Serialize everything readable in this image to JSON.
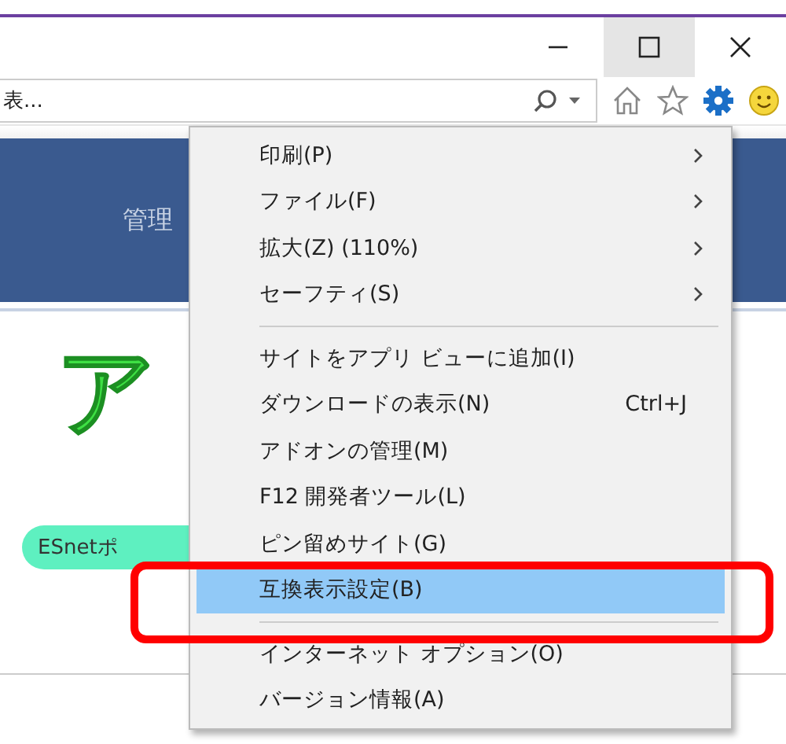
{
  "address_bar": {
    "value": "表..."
  },
  "page": {
    "nav_item": "管理",
    "logo_text": "ア",
    "portal_button": "ESnetポ"
  },
  "menu": {
    "items": [
      {
        "kind": "item",
        "label": "印刷(P)",
        "submenu": true,
        "selected": false
      },
      {
        "kind": "item",
        "label": "ファイル(F)",
        "submenu": true,
        "selected": false
      },
      {
        "kind": "item",
        "label": "拡大(Z) (110%)",
        "submenu": true,
        "selected": false
      },
      {
        "kind": "item",
        "label": "セーフティ(S)",
        "submenu": true,
        "selected": false
      },
      {
        "kind": "separator"
      },
      {
        "kind": "item",
        "label": "サイトをアプリ ビューに追加(I)",
        "submenu": false,
        "selected": false
      },
      {
        "kind": "item",
        "label": "ダウンロードの表示(N)",
        "shortcut": "Ctrl+J",
        "submenu": false,
        "selected": false
      },
      {
        "kind": "item",
        "label": "アドオンの管理(M)",
        "submenu": false,
        "selected": false
      },
      {
        "kind": "item",
        "label": "F12 開発者ツール(L)",
        "submenu": false,
        "selected": false
      },
      {
        "kind": "item",
        "label": "ピン留めサイト(G)",
        "submenu": false,
        "selected": false
      },
      {
        "kind": "item",
        "label": "互換表示設定(B)",
        "submenu": false,
        "selected": true
      },
      {
        "kind": "separator"
      },
      {
        "kind": "item",
        "label": "インターネット オプション(O)",
        "submenu": false,
        "selected": false
      },
      {
        "kind": "item",
        "label": "バージョン情報(A)",
        "submenu": false,
        "selected": false
      }
    ]
  }
}
